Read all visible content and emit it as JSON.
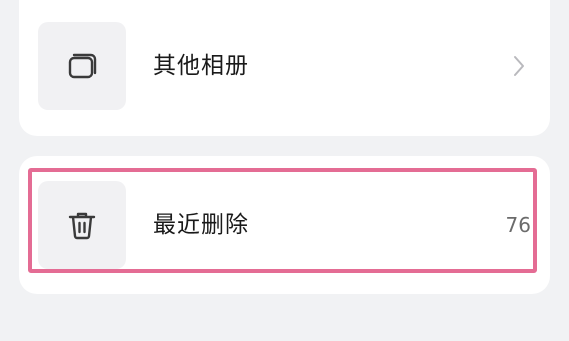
{
  "albums": {
    "other": {
      "label": "其他相册",
      "icon": "album-stack-icon"
    },
    "recently_deleted": {
      "label": "最近删除",
      "count": "76",
      "icon": "trash-icon"
    }
  },
  "highlight_color": "#e46c94"
}
